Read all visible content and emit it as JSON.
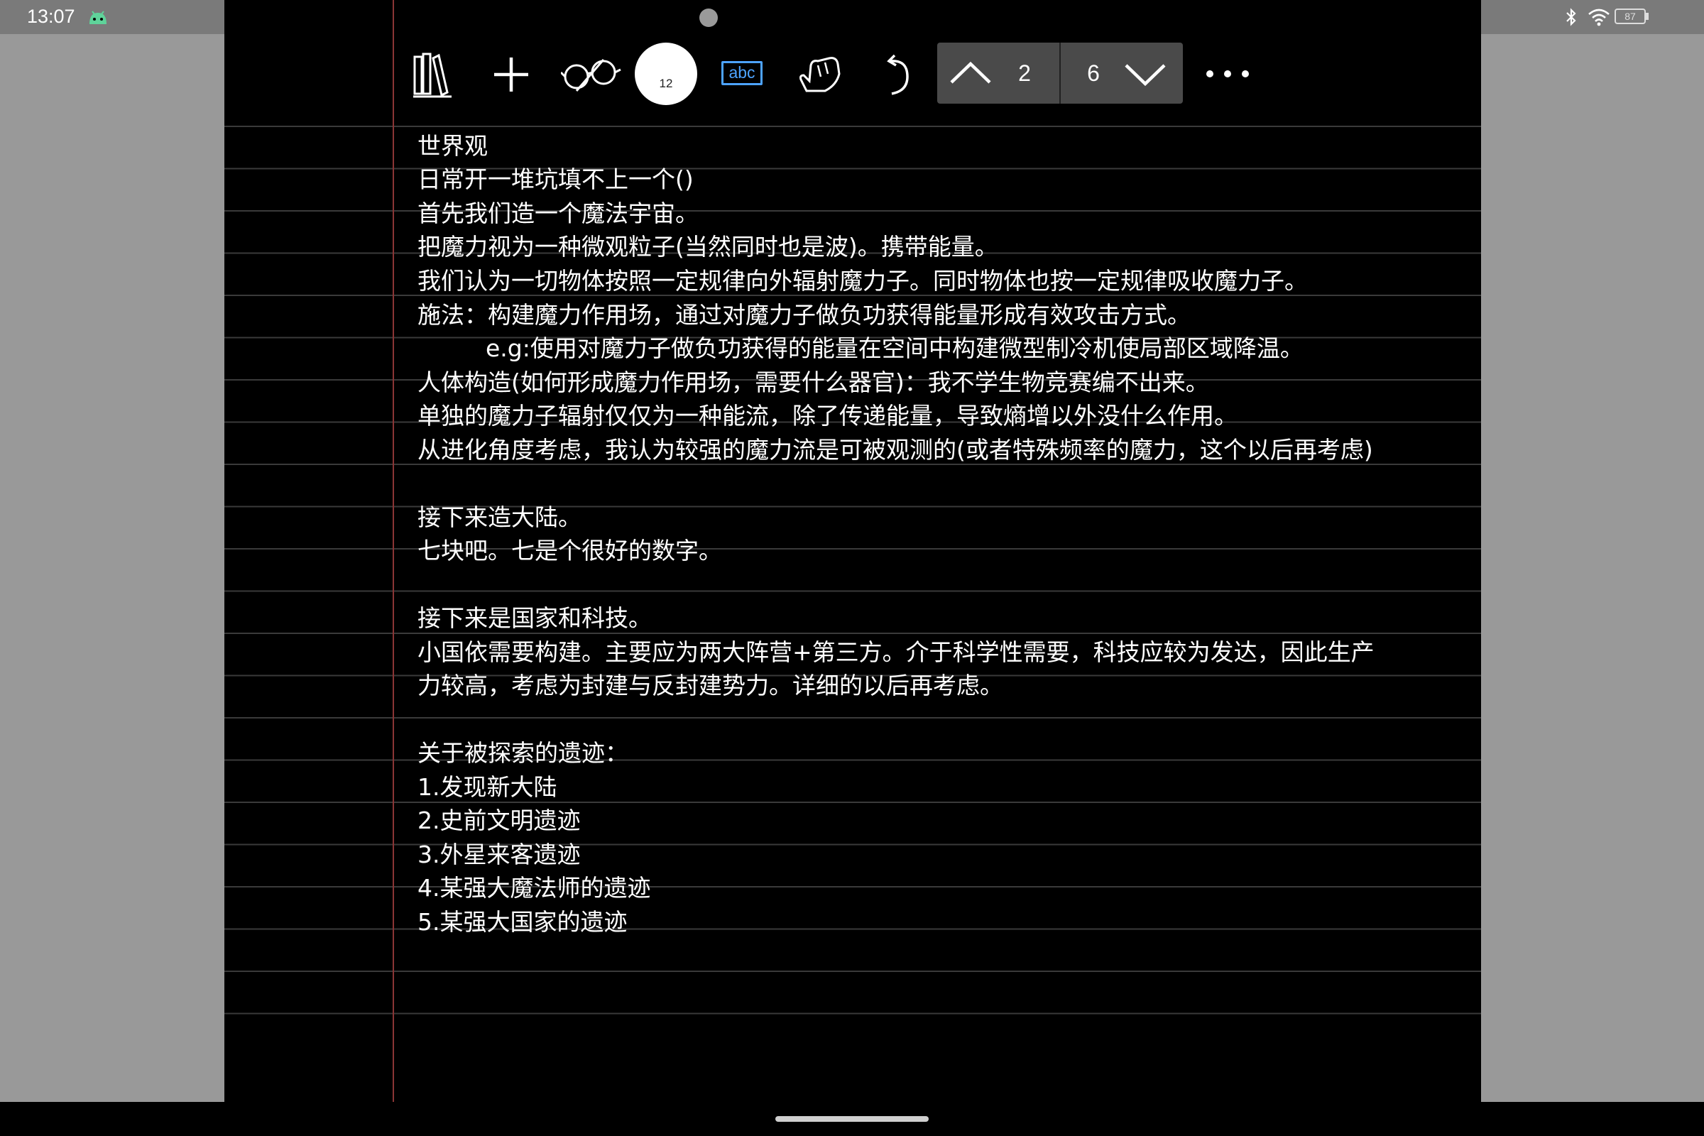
{
  "status_bar": {
    "time": "13:07",
    "app_icon": "android-robot-icon",
    "icons": [
      "bluetooth-icon",
      "wifi-icon"
    ],
    "battery": "87"
  },
  "toolbar": {
    "icons": [
      "library-icon",
      "add-icon",
      "glasses-icon",
      "pen-icon",
      "text-abc-icon",
      "hand-icon",
      "undo-icon",
      "more-icon"
    ],
    "pen_size": "12",
    "text_tool_label": "abc",
    "page_nav": {
      "current_page": "2",
      "total_pages": "6",
      "prev_icon": "chevron-up-icon",
      "next_icon": "chevron-down-icon"
    }
  },
  "colors": {
    "page_background": "#000000",
    "ruled_line": "#3a3a3a",
    "margin_line": "#8a3535",
    "text": "#ffffff",
    "text_tool_accent": "#4da3ff",
    "side_panel": "#999999"
  },
  "note": {
    "lines": [
      "世界观",
      "日常开一堆坑填不上一个()",
      "首先我们造一个魔法宇宙。",
      "把魔力视为一种微观粒子(当然同时也是波)。携带能量。",
      "我们认为一切物体按照一定规律向外辐射魔力子。同时物体也按一定规律吸收魔力子。",
      "施法：构建魔力作用场，通过对魔力子做负功获得能量形成有效攻击方式。",
      "e.g:使用对魔力子做负功获得的能量在空间中构建微型制冷机使局部区域降温。",
      "人体构造(如何形成魔力作用场，需要什么器官)：我不学生物竞赛编不出来。",
      "单独的魔力子辐射仅仅为一种能流，除了传递能量，导致熵增以外没什么作用。",
      "从进化角度考虑，我认为较强的魔力流是可被观测的(或者特殊频率的魔力，这个以后再考虑)",
      "接下来造大陆。",
      "七块吧。七是个很好的数字。",
      "接下来是国家和科技。",
      "小国依需要构建。主要应为两大阵营+第三方。介于科学性需要，科技应较为发达，因此生产",
      "力较高，考虑为封建与反封建势力。详细的以后再考虑。",
      "关于被探索的遗迹：",
      "1.发现新大陆",
      "2.史前文明遗迹",
      "3.外星来客遗迹",
      "4.某强大魔法师的遗迹",
      "5.某强大国家的遗迹"
    ]
  }
}
